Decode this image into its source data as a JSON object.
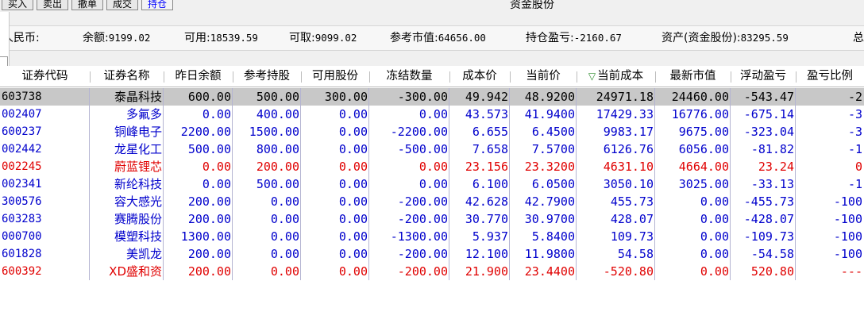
{
  "toolbar": {
    "buttons": [
      {
        "label": "买入",
        "active": false
      },
      {
        "label": "卖出",
        "active": false
      },
      {
        "label": "撤单",
        "active": false
      },
      {
        "label": "成交",
        "active": false
      },
      {
        "label": "持仓",
        "active": true
      }
    ],
    "title": "资金股份"
  },
  "summary": {
    "currency_label": "人民币:",
    "items": [
      {
        "label": "余额:",
        "value": "9199.02"
      },
      {
        "label": "可用:",
        "value": "18539.59"
      },
      {
        "label": "可取:",
        "value": "9099.02"
      },
      {
        "label": "参考市值:",
        "value": "64656.00"
      },
      {
        "label": "持仓盈亏:",
        "value": "-2160.67"
      },
      {
        "label": "资产(资金股份):",
        "value": "83295.59"
      }
    ],
    "trailing": "总"
  },
  "table": {
    "sort_icon": "▽",
    "columns": [
      "证券代码",
      "证券名称",
      "昨日余额",
      "参考持股",
      "可用股份",
      "冻结数量",
      "成本价",
      "当前价",
      "当前成本",
      "最新市值",
      "浮动盈亏",
      "盈亏比例"
    ],
    "colors": {
      "blue": "#0000cc",
      "red": "#e00000",
      "selected_bg": "#c8c8c8"
    },
    "rows": [
      {
        "color": "blue",
        "selected": true,
        "cells": [
          "603738",
          "泰晶科技",
          "600.00",
          "500.00",
          "300.00",
          "-300.00",
          "49.942",
          "48.9200",
          "24971.18",
          "24460.00",
          "-543.47",
          "-2"
        ]
      },
      {
        "color": "blue",
        "selected": false,
        "cells": [
          "002407",
          "多氟多",
          "0.00",
          "400.00",
          "0.00",
          "0.00",
          "43.573",
          "41.9400",
          "17429.33",
          "16776.00",
          "-675.14",
          "-3"
        ]
      },
      {
        "color": "blue",
        "selected": false,
        "cells": [
          "600237",
          "铜峰电子",
          "2200.00",
          "1500.00",
          "0.00",
          "-2200.00",
          "6.655",
          "6.4500",
          "9983.17",
          "9675.00",
          "-323.04",
          "-3"
        ]
      },
      {
        "color": "blue",
        "selected": false,
        "cells": [
          "002442",
          "龙星化工",
          "500.00",
          "800.00",
          "0.00",
          "-500.00",
          "7.658",
          "7.5700",
          "6126.76",
          "6056.00",
          "-81.82",
          "-1"
        ]
      },
      {
        "color": "red",
        "selected": false,
        "cells": [
          "002245",
          "蔚蓝锂芯",
          "0.00",
          "200.00",
          "0.00",
          "0.00",
          "23.156",
          "23.3200",
          "4631.10",
          "4664.00",
          "23.24",
          "0"
        ]
      },
      {
        "color": "blue",
        "selected": false,
        "cells": [
          "002341",
          "新纶科技",
          "0.00",
          "500.00",
          "0.00",
          "0.00",
          "6.100",
          "6.0500",
          "3050.10",
          "3025.00",
          "-33.13",
          "-1"
        ]
      },
      {
        "color": "blue",
        "selected": false,
        "cells": [
          "300576",
          "容大感光",
          "200.00",
          "0.00",
          "0.00",
          "-200.00",
          "42.628",
          "42.7900",
          "455.73",
          "0.00",
          "-455.73",
          "-100"
        ]
      },
      {
        "color": "blue",
        "selected": false,
        "cells": [
          "603283",
          "赛腾股份",
          "200.00",
          "0.00",
          "0.00",
          "-200.00",
          "30.770",
          "30.9700",
          "428.07",
          "0.00",
          "-428.07",
          "-100"
        ]
      },
      {
        "color": "blue",
        "selected": false,
        "cells": [
          "000700",
          "模塑科技",
          "1300.00",
          "0.00",
          "0.00",
          "-1300.00",
          "5.937",
          "5.8400",
          "109.73",
          "0.00",
          "-109.73",
          "-100"
        ]
      },
      {
        "color": "blue",
        "selected": false,
        "cells": [
          "601828",
          "美凯龙",
          "200.00",
          "0.00",
          "0.00",
          "-200.00",
          "12.100",
          "11.9800",
          "54.58",
          "0.00",
          "-54.58",
          "-100"
        ]
      },
      {
        "color": "red",
        "selected": false,
        "cells": [
          "600392",
          "XD盛和资",
          "200.00",
          "0.00",
          "0.00",
          "-200.00",
          "21.900",
          "23.4400",
          "-520.80",
          "0.00",
          "520.80",
          "---"
        ]
      }
    ]
  }
}
